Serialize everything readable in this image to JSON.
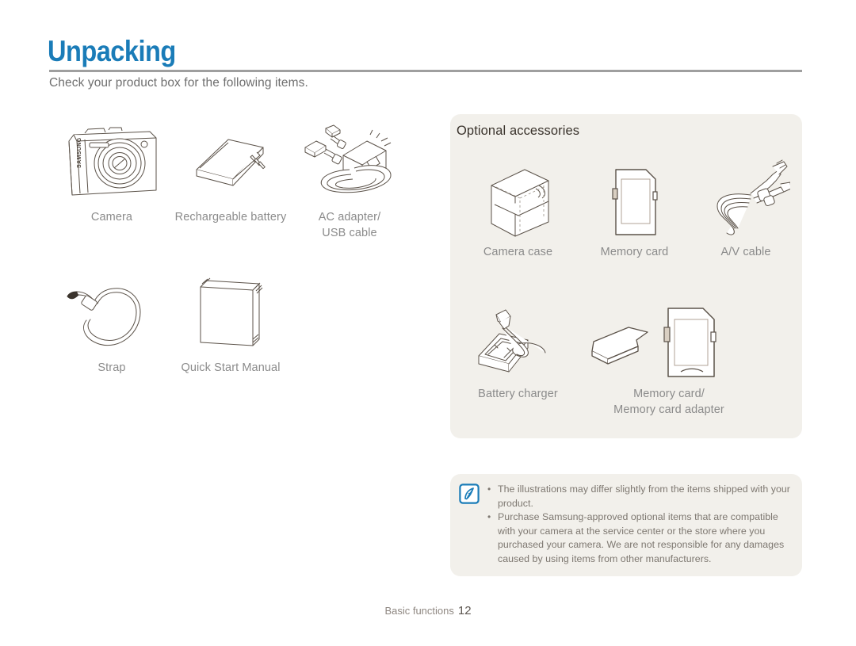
{
  "page": {
    "title": "Unpacking",
    "subtitle": "Check your product box for the following items.",
    "title_color": "#1a7cb8",
    "rule_color": "#9f9f9f"
  },
  "included_items": [
    {
      "label": "Camera",
      "icon": "camera-icon"
    },
    {
      "label": "Rechargeable battery",
      "icon": "battery-icon"
    },
    {
      "label": "AC adapter/\nUSB cable",
      "icon": "ac-adapter-usb-cable-icon"
    },
    {
      "label": "Strap",
      "icon": "strap-icon"
    },
    {
      "label": "Quick Start Manual",
      "icon": "quick-start-manual-icon"
    }
  ],
  "optional": {
    "heading": "Optional accessories",
    "panel_color": "#f2f0eb",
    "items": [
      {
        "label": "Camera case",
        "icon": "camera-case-icon"
      },
      {
        "label": "Memory card",
        "icon": "memory-card-icon"
      },
      {
        "label": "A/V cable",
        "icon": "av-cable-icon"
      },
      {
        "label": "Battery charger",
        "icon": "battery-charger-icon"
      },
      {
        "label": "Memory card/\nMemory card adapter",
        "icon": "memory-card-adapter-icon"
      }
    ]
  },
  "note": {
    "icon": "note-pen-icon",
    "icon_color": "#1a7cb8",
    "bullets": [
      "The illustrations may differ slightly from the items shipped with your product.",
      "Purchase Samsung-approved optional items that are compatible with your camera at the service center or the store where you purchased your camera. We are not responsible for any damages caused by using items from other manufacturers."
    ]
  },
  "footer": {
    "section": "Basic functions",
    "page_number": "12"
  }
}
